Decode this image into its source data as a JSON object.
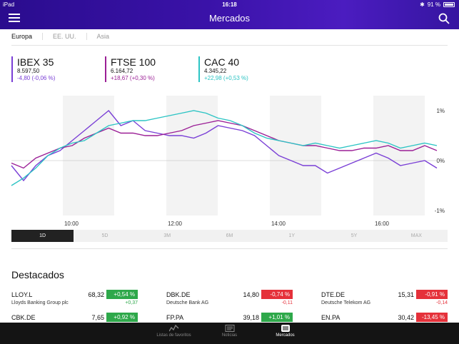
{
  "status": {
    "carrier": "iPad",
    "time": "16:18",
    "battery": "91 %"
  },
  "header": {
    "title": "Mercados",
    "menu_icon": "hamburger-icon",
    "search_icon": "search-icon"
  },
  "regions": [
    "Europa",
    "EE. UU.",
    "Asia"
  ],
  "indices": [
    {
      "name": "IBEX 35",
      "price": "8.597,50",
      "change": "-4,80 (-0,06 %)",
      "color": "#7a3fd6"
    },
    {
      "name": "FTSE 100",
      "price": "6.164,72",
      "change": "+18,67 (+0,30 %)",
      "color": "#9b1f96"
    },
    {
      "name": "CAC 40",
      "price": "4.345,22",
      "change": "+22,98 (+0,53 %)",
      "color": "#2cc4c4"
    }
  ],
  "chart_data": {
    "type": "line",
    "x_ticks": [
      "10:00",
      "12:00",
      "14:00",
      "16:00"
    ],
    "y_ticks": [
      "1%",
      "0%",
      "-1%"
    ],
    "ylim": [
      -1.1,
      1.3
    ],
    "series": [
      {
        "name": "IBEX 35",
        "color": "#7a3fd6",
        "values": [
          -0.1,
          -0.4,
          -0.1,
          0.1,
          0.2,
          0.4,
          0.6,
          0.8,
          1.0,
          0.7,
          0.8,
          0.6,
          0.55,
          0.5,
          0.5,
          0.45,
          0.55,
          0.7,
          0.65,
          0.6,
          0.5,
          0.3,
          0.1,
          0.0,
          -0.1,
          -0.1,
          -0.25,
          -0.15,
          -0.05,
          0.05,
          0.15,
          0.05,
          -0.1,
          -0.05,
          0.0,
          -0.15
        ]
      },
      {
        "name": "FTSE 100",
        "color": "#9b1f96",
        "values": [
          -0.05,
          -0.15,
          0.05,
          0.15,
          0.25,
          0.3,
          0.45,
          0.55,
          0.65,
          0.55,
          0.55,
          0.5,
          0.5,
          0.55,
          0.6,
          0.7,
          0.75,
          0.8,
          0.75,
          0.7,
          0.6,
          0.5,
          0.4,
          0.35,
          0.3,
          0.3,
          0.25,
          0.2,
          0.2,
          0.25,
          0.25,
          0.3,
          0.2,
          0.2,
          0.3,
          0.2
        ]
      },
      {
        "name": "CAC 40",
        "color": "#2cc4c4",
        "values": [
          -0.5,
          -0.35,
          -0.15,
          0.1,
          0.25,
          0.35,
          0.4,
          0.55,
          0.7,
          0.75,
          0.8,
          0.8,
          0.85,
          0.9,
          0.95,
          1.0,
          0.95,
          0.85,
          0.8,
          0.7,
          0.55,
          0.45,
          0.4,
          0.35,
          0.3,
          0.35,
          0.3,
          0.25,
          0.3,
          0.35,
          0.4,
          0.35,
          0.25,
          0.3,
          0.35,
          0.3
        ]
      }
    ]
  },
  "ranges": [
    "1D",
    "5D",
    "3M",
    "6M",
    "1Y",
    "5Y",
    "MAX"
  ],
  "highlights": {
    "title": "Destacados",
    "items": [
      {
        "symbol": "LLOY.L",
        "price": "68,32",
        "change": "+0,54 %",
        "name": "Lloyds Banking Group plc",
        "abs": "+0,37",
        "color": "#2ea84a"
      },
      {
        "symbol": "DBK.DE",
        "price": "14,80",
        "change": "-0,74 %",
        "name": "Deutsche Bank AG",
        "abs": "-0,11",
        "color": "#e5313a"
      },
      {
        "symbol": "DTE.DE",
        "price": "15,31",
        "change": "-0,91 %",
        "name": "Deutsche Telekom AG",
        "abs": "-0,14",
        "color": "#e5313a"
      },
      {
        "symbol": "CBK.DE",
        "price": "7,65",
        "change": "+0,92 %",
        "name": "",
        "abs": "",
        "color": "#2ea84a"
      },
      {
        "symbol": "FP.PA",
        "price": "39,18",
        "change": "+1,01 %",
        "name": "",
        "abs": "",
        "color": "#2ea84a"
      },
      {
        "symbol": "EN.PA",
        "price": "30,42",
        "change": "-13,45 %",
        "name": "",
        "abs": "",
        "color": "#e5313a"
      }
    ]
  },
  "tabbar": [
    {
      "label": "Listas de favoritos",
      "icon": "watchlist-icon"
    },
    {
      "label": "Noticias",
      "icon": "news-icon"
    },
    {
      "label": "Mercados",
      "icon": "markets-icon"
    }
  ]
}
